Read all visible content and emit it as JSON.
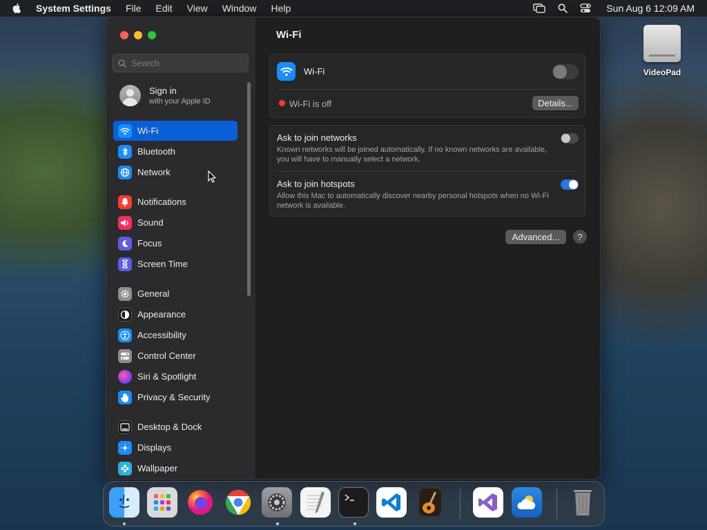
{
  "menubar": {
    "app_name": "System Settings",
    "menus": [
      "File",
      "Edit",
      "View",
      "Window",
      "Help"
    ],
    "clock": "Sun Aug 6  12:09 AM"
  },
  "desktop": {
    "icon_label": "VideoPad"
  },
  "sidebar": {
    "search_placeholder": "Search",
    "account": {
      "title": "Sign in",
      "subtitle": "with your Apple ID"
    },
    "items": [
      {
        "label": "Wi-Fi",
        "icon": "wifi-icon",
        "color": "#1a8cff"
      },
      {
        "label": "Bluetooth",
        "icon": "bluetooth-icon",
        "color": "#1a8cff"
      },
      {
        "label": "Network",
        "icon": "globe-icon",
        "color": "#1a8cff"
      },
      {
        "label": "Notifications",
        "icon": "bell-icon",
        "color": "#ff3b30"
      },
      {
        "label": "Sound",
        "icon": "speaker-icon",
        "color": "#ff2d55"
      },
      {
        "label": "Focus",
        "icon": "moon-icon",
        "color": "#5e5ce6"
      },
      {
        "label": "Screen Time",
        "icon": "hourglass-icon",
        "color": "#5e5ce6"
      },
      {
        "label": "General",
        "icon": "gear-icon",
        "color": "#8e8e93"
      },
      {
        "label": "Appearance",
        "icon": "appearance-icon",
        "color": "#1c1c1e"
      },
      {
        "label": "Accessibility",
        "icon": "accessibility-icon",
        "color": "#1a8cff"
      },
      {
        "label": "Control Center",
        "icon": "control-center-icon",
        "color": "#8e8e93"
      },
      {
        "label": "Siri & Spotlight",
        "icon": "siri-icon",
        "color": "#a040e0"
      },
      {
        "label": "Privacy & Security",
        "icon": "hand-icon",
        "color": "#1a8cff"
      },
      {
        "label": "Desktop & Dock",
        "icon": "dock-icon",
        "color": "#1c1c1e"
      },
      {
        "label": "Displays",
        "icon": "display-icon",
        "color": "#1a8cff"
      },
      {
        "label": "Wallpaper",
        "icon": "wallpaper-icon",
        "color": "#30b0e0"
      }
    ],
    "selected": "Wi-Fi"
  },
  "content": {
    "title": "Wi-Fi",
    "wifi_card": {
      "label": "Wi-Fi",
      "enabled": false,
      "status": "Wi-Fi is off",
      "details_button": "Details..."
    },
    "options": [
      {
        "title": "Ask to join networks",
        "description": "Known networks will be joined automatically. If no known networks are available, you will have to manually select a network.",
        "enabled": false
      },
      {
        "title": "Ask to join hotspots",
        "description": "Allow this Mac to automatically discover nearby personal hotspots when no Wi-Fi network is available.",
        "enabled": true
      }
    ],
    "advanced_button": "Advanced...",
    "help_button": "?"
  },
  "colors": {
    "accent": "#0a5fd6",
    "toggle_on": "#2a74e6",
    "status_off": "#ff3b30"
  },
  "dock": {
    "apps": [
      "finder-icon",
      "launchpad-icon",
      "firefox-icon",
      "chrome-icon",
      "system-settings-icon",
      "textedit-icon",
      "terminal-icon",
      "vscode-icon",
      "garageband-icon",
      "visual-studio-icon",
      "weather-icon",
      "trash-icon"
    ]
  }
}
